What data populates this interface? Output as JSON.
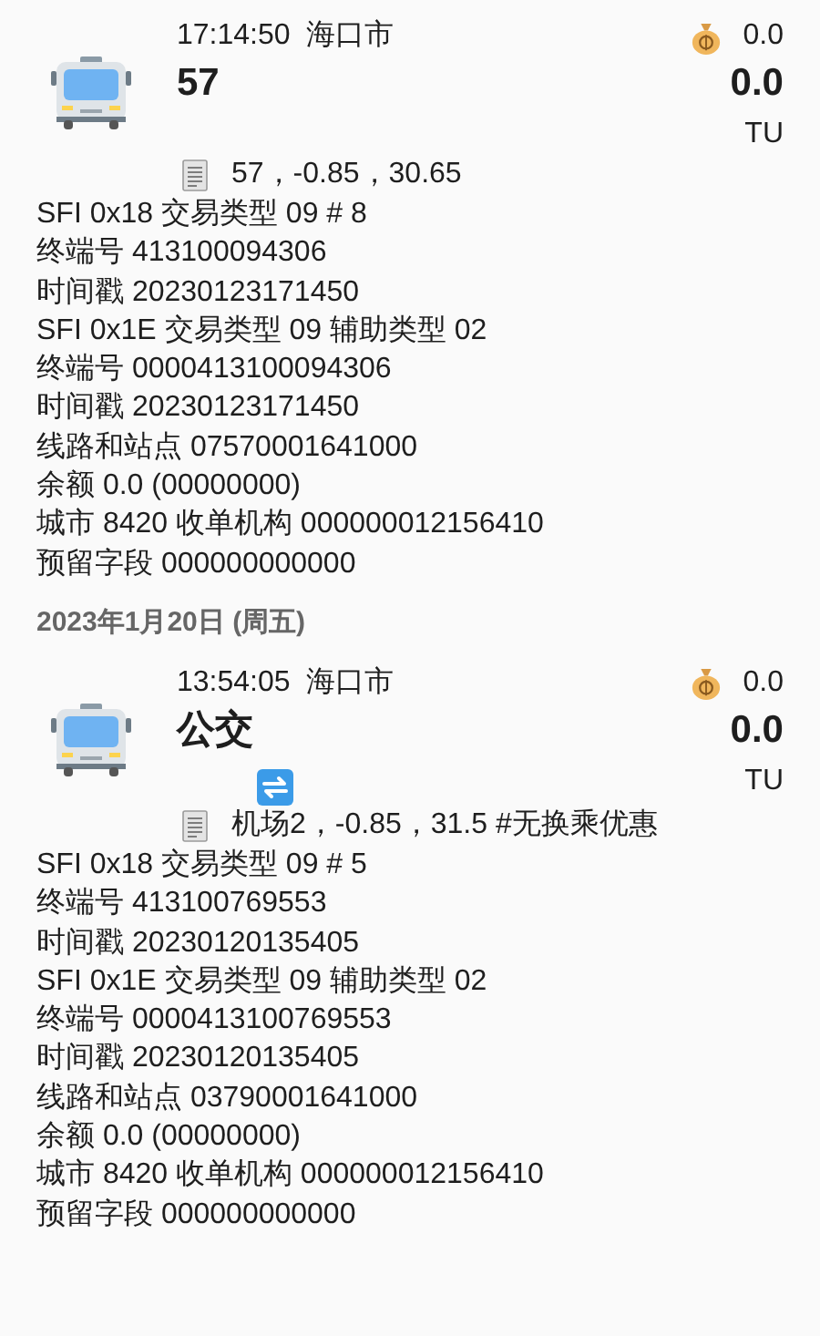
{
  "items": [
    {
      "kind": "transaction",
      "time": "17:14:50",
      "city": "海口市",
      "route": "57",
      "transfer": false,
      "fee": "0.0",
      "amount": "0.0",
      "unit": "TU",
      "note": "57，-0.85，30.65",
      "details": [
        "SFI 0x18  交易类型 09  # 8",
        "终端号 413100094306",
        "时间戳 20230123171450",
        "SFI 0x1E  交易类型 09  辅助类型 02",
        "终端号 0000413100094306",
        "时间戳 20230123171450",
        "线路和站点 07570001641000",
        "余额 0.0 (00000000)",
        "城市 8420  收单机构 000000012156410",
        "预留字段 000000000000"
      ]
    },
    {
      "kind": "date",
      "text": "2023年1月20日 (周五)"
    },
    {
      "kind": "transaction",
      "time": "13:54:05",
      "city": "海口市",
      "route": "公交",
      "transfer": true,
      "fee": "0.0",
      "amount": "0.0",
      "unit": "TU",
      "note": "机场2，-0.85，31.5 #无换乘优惠",
      "details": [
        "SFI 0x18  交易类型 09  # 5",
        "终端号 413100769553",
        "时间戳 20230120135405",
        "SFI 0x1E  交易类型 09  辅助类型 02",
        "终端号 0000413100769553",
        "时间戳 20230120135405",
        "线路和站点 03790001641000",
        "余额 0.0 (00000000)",
        "城市 8420  收单机构 000000012156410",
        "预留字段 000000000000"
      ]
    }
  ]
}
